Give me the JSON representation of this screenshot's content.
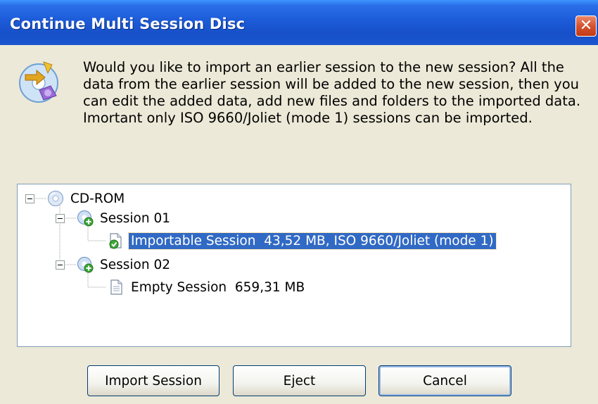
{
  "window": {
    "title": "Continue Multi Session Disc",
    "close_glyph": "✕"
  },
  "message": "Would you like to import an earlier session to the new session? All the data from the earlier session will be added to the new session, then you can edit the added data, add new files and folders to the imported data. Imortant only ISO 9660/Joliet (mode 1) sessions can be imported.",
  "tree": {
    "root": {
      "label": "CD-ROM",
      "icon": "cd-icon",
      "expanded": true
    },
    "sessions": [
      {
        "label": "Session 01",
        "icon": "session-disc-icon",
        "expanded": true,
        "child": {
          "label": "Importable Session  43,52 MB, ISO 9660/Joliet (mode 1)",
          "icon": "importable-document-icon",
          "selected": true
        }
      },
      {
        "label": "Session 02",
        "icon": "session-disc-icon",
        "expanded": true,
        "child": {
          "label": "Empty Session  659,31 MB",
          "icon": "document-icon",
          "selected": false
        }
      }
    ]
  },
  "buttons": {
    "import": "Import Session",
    "eject": "Eject",
    "cancel": "Cancel"
  },
  "colors": {
    "titlebar": "#1c5bd8",
    "selection": "#316ac5",
    "dialog_bg": "#ece9d8",
    "close": "#d5532f"
  }
}
